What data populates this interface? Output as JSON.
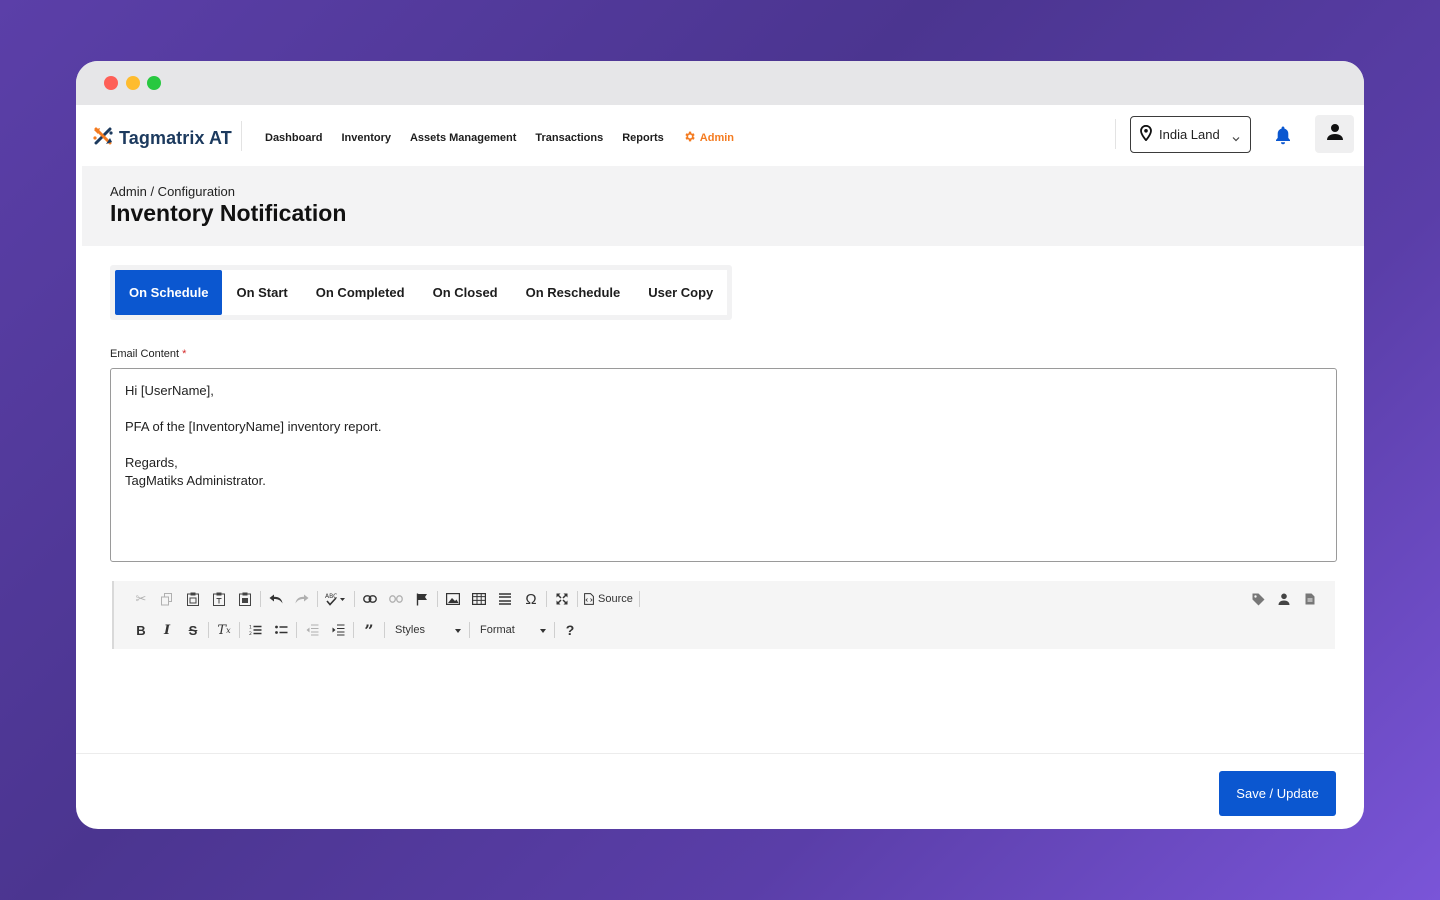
{
  "app": {
    "name": "Tagmatrix AT"
  },
  "nav": {
    "links": [
      {
        "label": "Dashboard"
      },
      {
        "label": "Inventory"
      },
      {
        "label": "Assets Management"
      },
      {
        "label": "Transactions"
      },
      {
        "label": "Reports"
      }
    ],
    "admin_label": "Admin",
    "location": "India Land"
  },
  "header": {
    "breadcrumb": "Admin / Configuration",
    "title": "Inventory Notification"
  },
  "tabs": [
    {
      "label": "On Schedule",
      "active": true
    },
    {
      "label": "On Start",
      "active": false
    },
    {
      "label": "On Completed",
      "active": false
    },
    {
      "label": "On Closed",
      "active": false
    },
    {
      "label": "On Reschedule",
      "active": false
    },
    {
      "label": "User Copy",
      "active": false
    }
  ],
  "email": {
    "label": "Email Content",
    "required_mark": "*",
    "lines": [
      "Hi [UserName],",
      "",
      "PFA of the [InventoryName] inventory report.",
      "",
      "Regards,",
      "TagMatiks Administrator."
    ]
  },
  "toolbar": {
    "source_label": "Source",
    "styles_label": "Styles",
    "format_label": "Format"
  },
  "actions": {
    "save_label": "Save / Update"
  },
  "colors": {
    "primary": "#0b57d0",
    "accent": "#f47b20"
  }
}
